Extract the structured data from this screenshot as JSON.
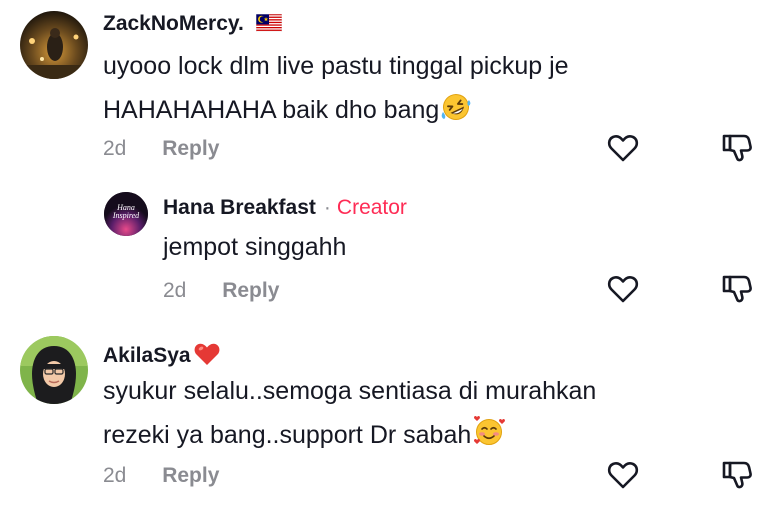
{
  "comments": [
    {
      "username": "ZackNoMercy.",
      "flag_icon": "malaysia-flag-icon",
      "text_line1": "uyooo lock dlm live pastu tinggal pickup je",
      "text_line2": "HAHAHAHAHA baik dho bang",
      "trailing_emoji": "rolling-on-floor-laughing-emoji",
      "age": "2d",
      "reply_label": "Reply"
    },
    {
      "username": "Hana Breakfast",
      "separator": "·",
      "badge": "Creator",
      "avatar_text_line1": "Hana",
      "avatar_text_line2": "Inspired",
      "text_line1": "jempot singgahh",
      "age": "2d",
      "reply_label": "Reply"
    },
    {
      "username": "AkilaSya",
      "username_emoji": "red-heart-emoji",
      "text_line1": "syukur selalu..semoga sentiasa di murahkan",
      "text_line2": "rezeki ya bang..support Dr sabah",
      "trailing_emoji": "smiling-face-with-hearts-emoji",
      "age": "2d",
      "reply_label": "Reply"
    }
  ],
  "colors": {
    "text": "#161823",
    "muted": "#8a8b91",
    "creator": "#fe2c55",
    "icon_stroke": "#161823"
  }
}
